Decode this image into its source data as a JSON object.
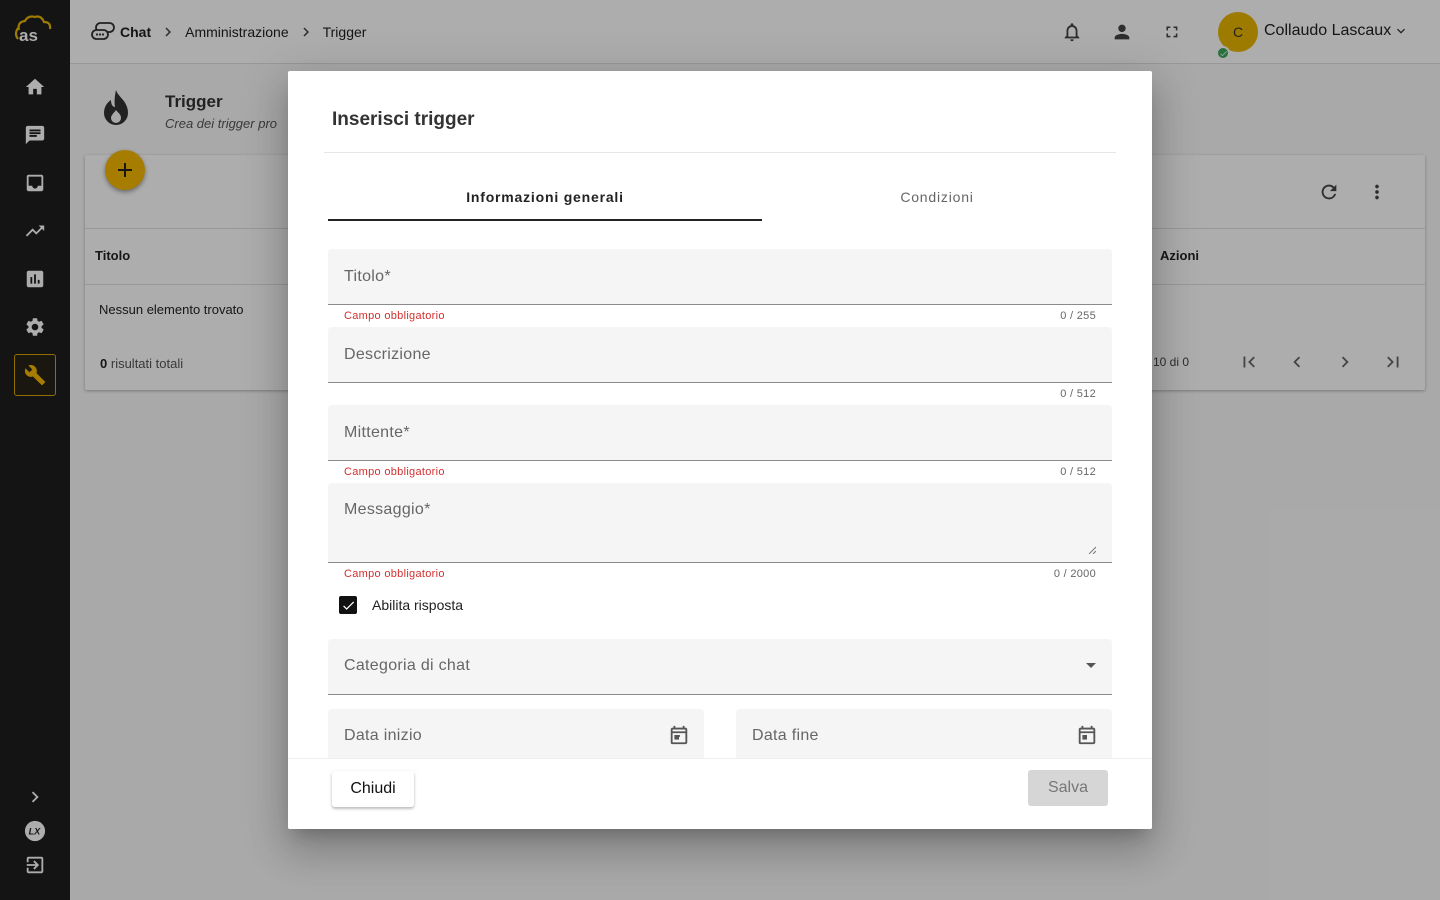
{
  "breadcrumb": {
    "items": [
      "Chat",
      "Amministrazione",
      "Trigger"
    ]
  },
  "user": {
    "initial": "C",
    "name": "Collaudo Lascaux"
  },
  "page": {
    "title": "Trigger",
    "subtitle": "Crea dei trigger pro",
    "table": {
      "headers": [
        "Titolo",
        "Azioni"
      ],
      "empty_text": "Nessun elemento trovato",
      "total_count": "0",
      "total_label": "risultati totali",
      "paging": "10 di 0"
    }
  },
  "dialog": {
    "title": "Inserisci trigger",
    "tabs": [
      {
        "label": "Informazioni generali",
        "active": true
      },
      {
        "label": "Condizioni",
        "active": false
      }
    ],
    "fields": {
      "titolo": {
        "placeholder": "Titolo*",
        "error": "Campo obbligatorio",
        "counter": "0 / 255"
      },
      "descrizione": {
        "placeholder": "Descrizione",
        "counter": "0 / 512"
      },
      "mittente": {
        "placeholder": "Mittente*",
        "error": "Campo obbligatorio",
        "counter": "0 / 512"
      },
      "messaggio": {
        "placeholder": "Messaggio*",
        "error": "Campo obbligatorio",
        "counter": "0 / 2000"
      }
    },
    "checkbox": {
      "label": "Abilita risposta",
      "checked": true
    },
    "select": {
      "label": "Categoria di chat"
    },
    "date_start": {
      "label": "Data inizio"
    },
    "date_end": {
      "label": "Data fine"
    },
    "buttons": {
      "close": "Chiudi",
      "save": "Salva"
    }
  },
  "colors": {
    "accent": "#f5b800",
    "error": "#d32f2f",
    "sidebar": "#1e1e1e"
  }
}
